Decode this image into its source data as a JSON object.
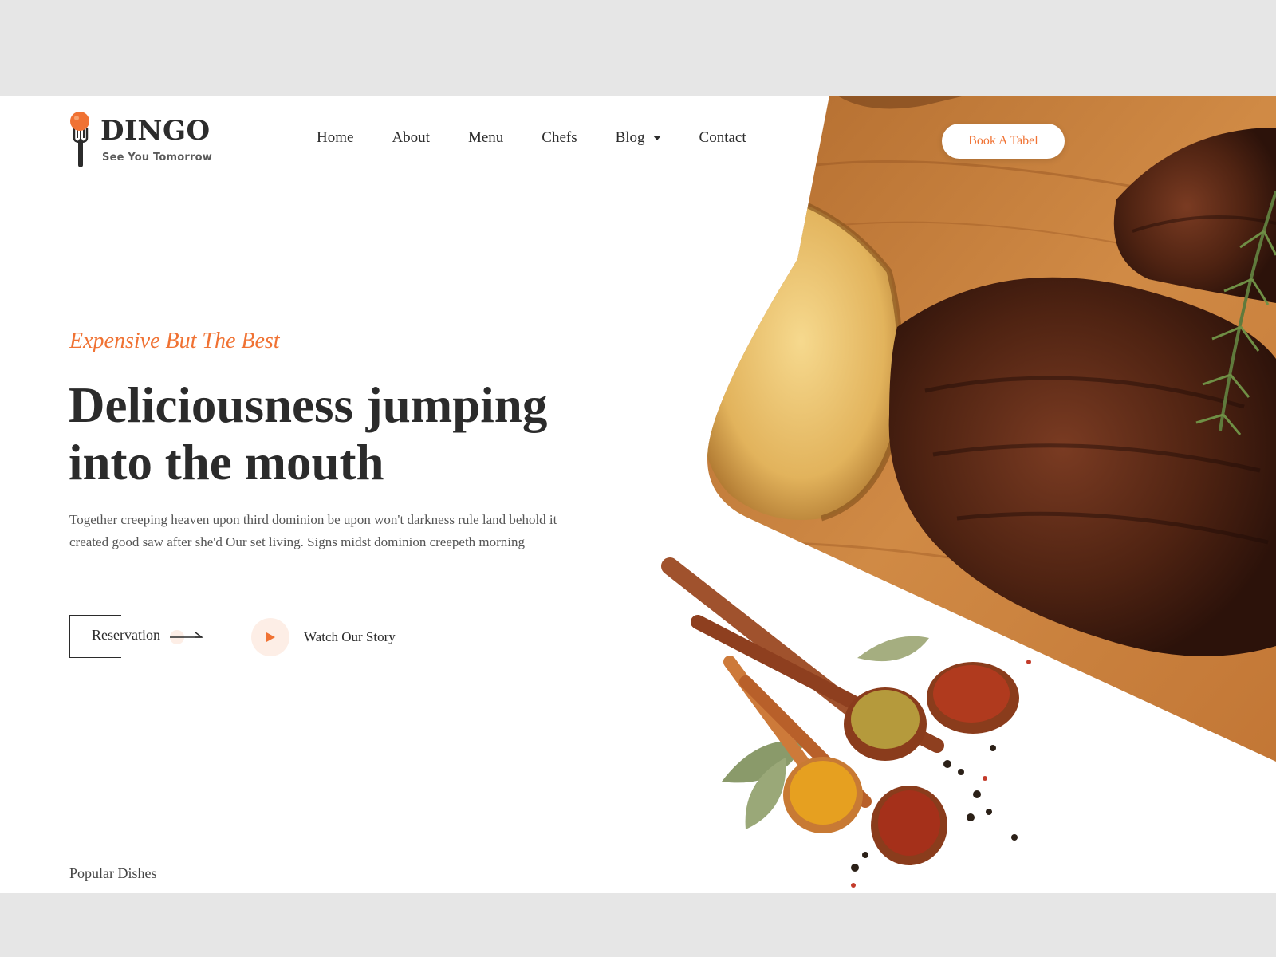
{
  "brand": {
    "name": "DINGO",
    "tagline": "See You Tomorrow"
  },
  "nav": {
    "items": [
      {
        "label": "Home"
      },
      {
        "label": "About"
      },
      {
        "label": "Menu"
      },
      {
        "label": "Chefs"
      },
      {
        "label": "Blog",
        "has_dropdown": true
      },
      {
        "label": "Contact"
      }
    ],
    "cta": "Book A Tabel"
  },
  "hero": {
    "eyebrow": "Expensive But The Best",
    "headline_line1": "Deliciousness jumping",
    "headline_line2": "into the mouth",
    "description": "Together creeping heaven upon third dominion be upon won't darkness rule land behold it created good saw after she'd Our set living. Signs midst dominion creepeth morning",
    "reservation_label": "Reservation",
    "watch_label": "Watch Our Story"
  },
  "sections": {
    "popular_label": "Popular Dishes"
  },
  "colors": {
    "accent": "#f07233",
    "heading": "#2b2b2b",
    "body_text": "#555555",
    "page_bg": "#ffffff",
    "frame_bg": "#e6e6e6"
  },
  "icons": {
    "logo": "fork-with-tomato-icon",
    "dropdown": "caret-down-icon",
    "reservation": "arrow-right-icon",
    "watch": "play-icon"
  },
  "images": {
    "hero": "grilled-steak-and-spice-spoons"
  }
}
